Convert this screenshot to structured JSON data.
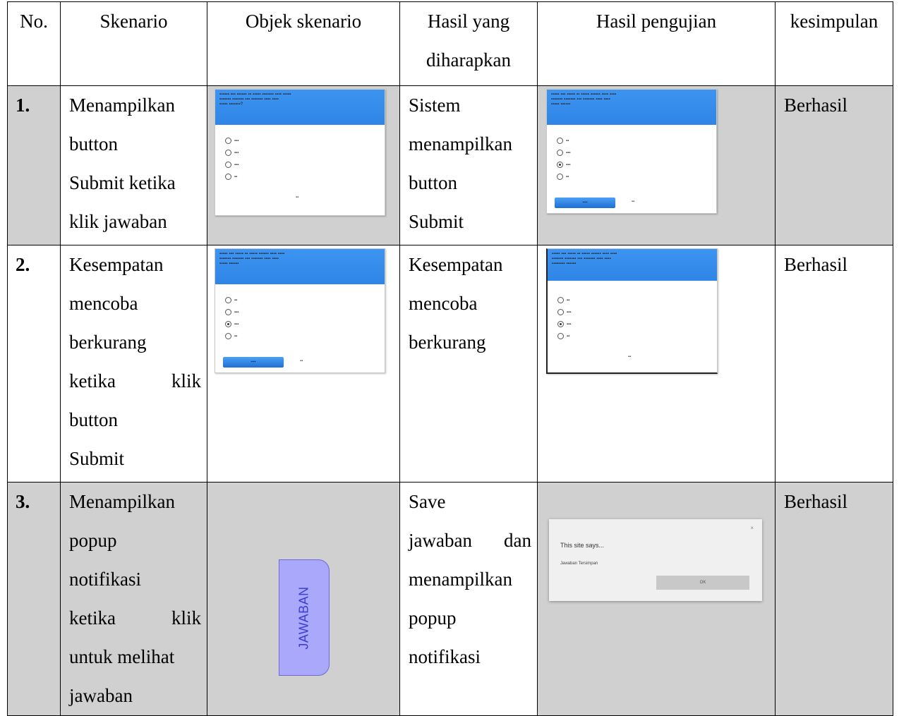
{
  "headers": {
    "no": "No.",
    "skenario": "Skenario",
    "objek": "Objek skenario",
    "harapan_line1": "Hasil yang",
    "harapan_line2": "diharapkan",
    "pengujian": "Hasil pengujian",
    "kesimpulan": "kesimpulan"
  },
  "rows": [
    {
      "no": "1.",
      "skenario": [
        "Menampilkan",
        "button",
        "Submit ketika",
        "klik jawaban"
      ],
      "harapan": [
        "Sistem",
        "menampilkan",
        "button",
        "Submit"
      ],
      "kesimpulan": "Berhasil"
    },
    {
      "no": "2.",
      "skenario": [
        "Kesempatan",
        "mencoba",
        "berkurang",
        "ketika klik",
        "button",
        "Submit"
      ],
      "harapan": [
        "Kesempatan",
        "mencoba",
        "berkurang"
      ],
      "kesimpulan": "Berhasil"
    },
    {
      "no": "3.",
      "skenario": [
        "Menampilkan",
        "popup",
        "notifikasi",
        "ketika klik",
        "untuk melihat",
        "jawaban"
      ],
      "harapan": [
        "Save",
        "jawaban dan",
        "menampilkan",
        "popup",
        "notifikasi"
      ],
      "kesimpulan": "Berhasil"
    }
  ],
  "popup": {
    "title": "This site says...",
    "message": "Jawaban Tersimpan",
    "ok_label": "OK",
    "close_label": "×"
  },
  "jawaban_button": "JAWABAN"
}
